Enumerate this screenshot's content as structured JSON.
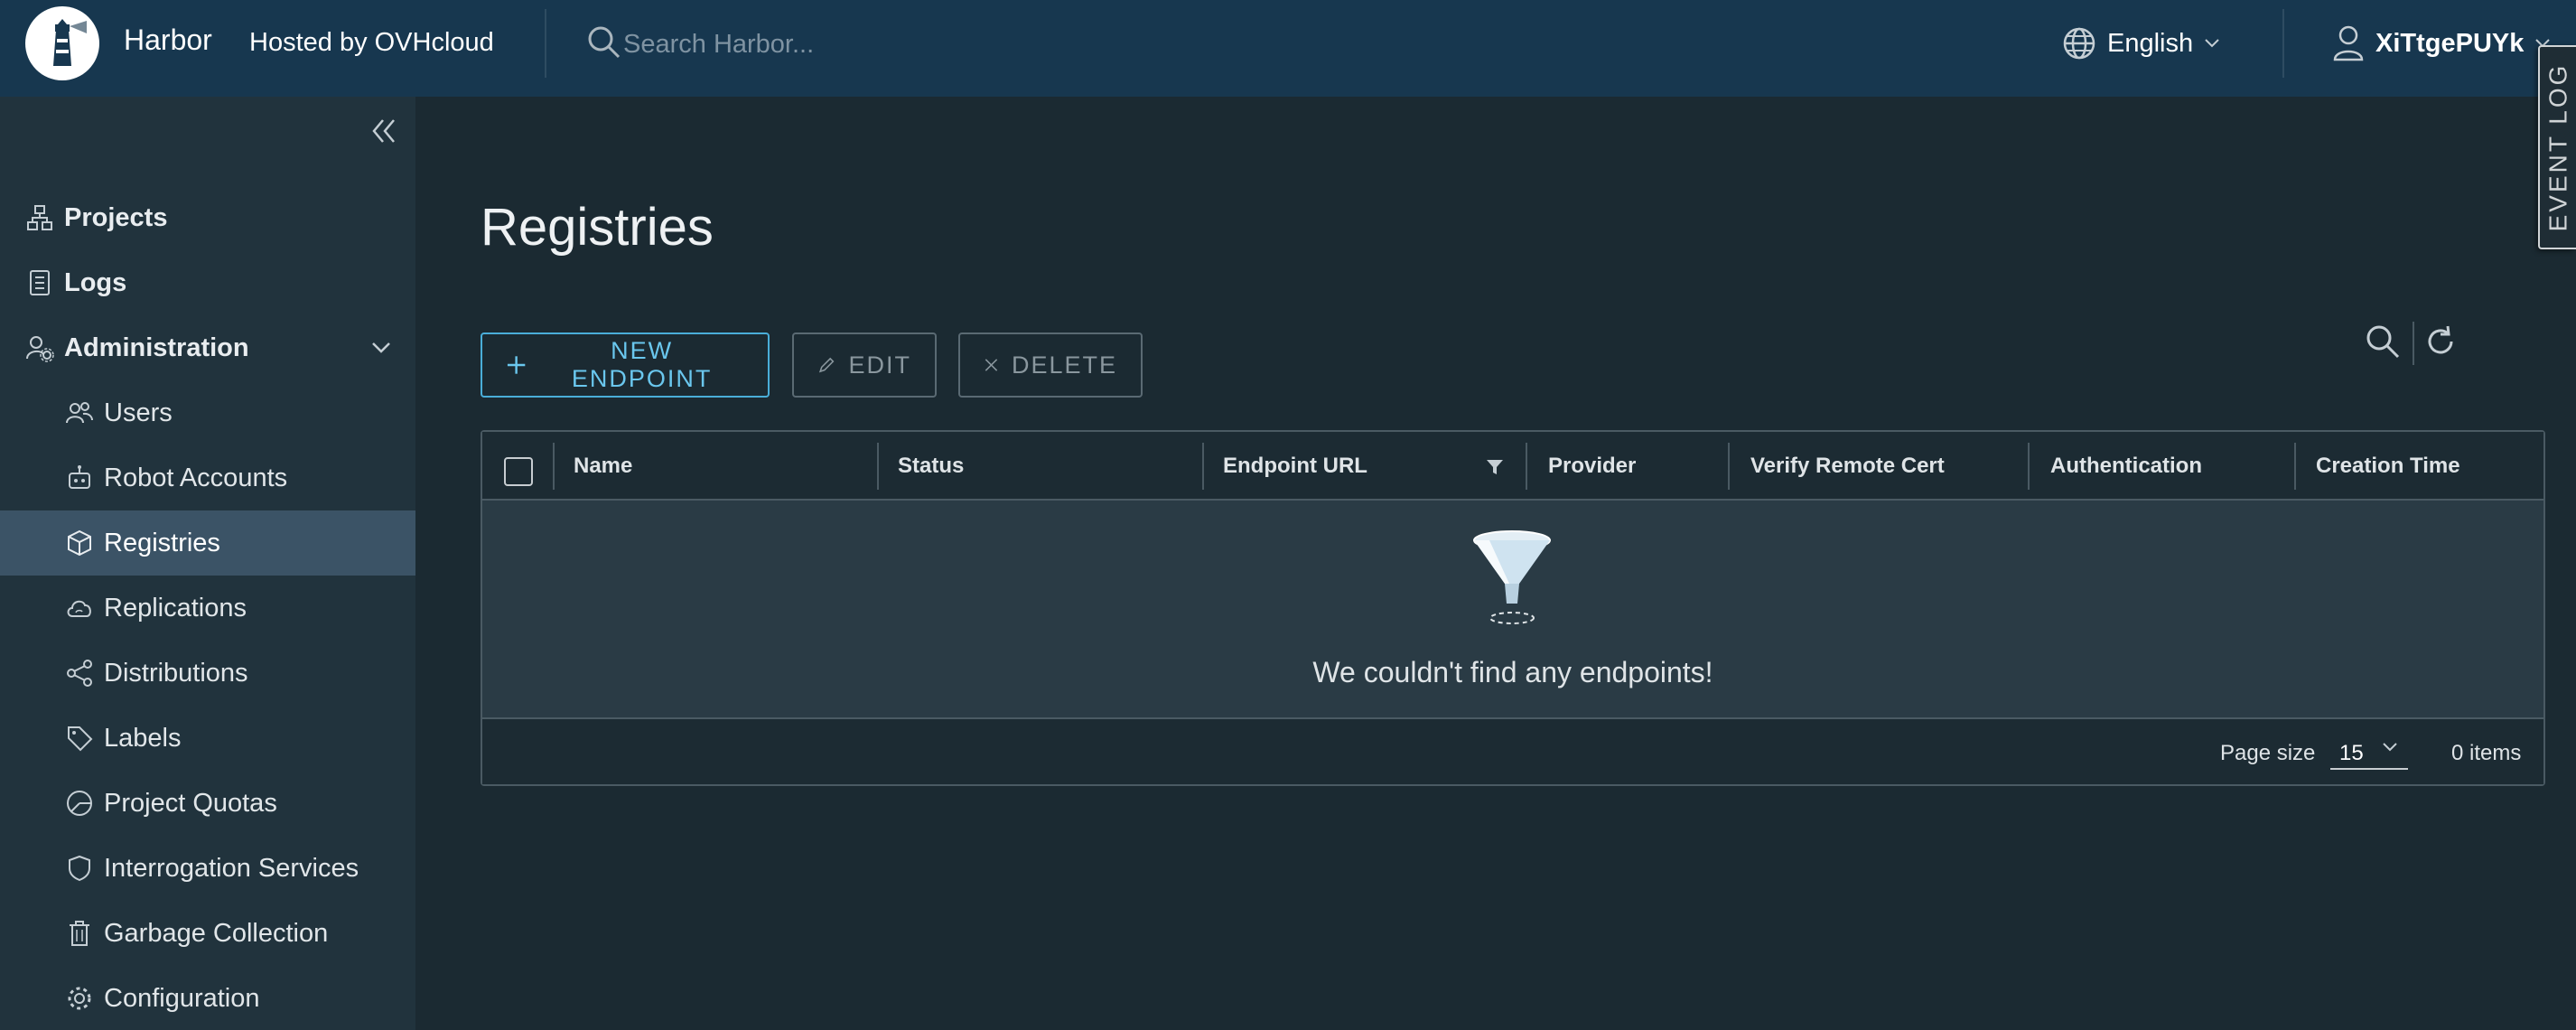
{
  "header": {
    "brand": "Harbor",
    "hosted_by": "Hosted by OVHcloud",
    "search_placeholder": "Search Harbor...",
    "language": "English",
    "username": "XiTtgePUYk",
    "event_log": "EVENT LOG"
  },
  "sidebar": {
    "items": [
      {
        "label": "Projects",
        "icon": "projects-icon"
      },
      {
        "label": "Logs",
        "icon": "logs-icon"
      },
      {
        "label": "Administration",
        "icon": "administration-icon",
        "expanded": true
      },
      {
        "label": "Users",
        "icon": "users-icon"
      },
      {
        "label": "Robot Accounts",
        "icon": "robot-icon"
      },
      {
        "label": "Registries",
        "icon": "registry-box-icon",
        "active": true
      },
      {
        "label": "Replications",
        "icon": "cloud-sync-icon"
      },
      {
        "label": "Distributions",
        "icon": "share-icon"
      },
      {
        "label": "Labels",
        "icon": "tag-icon"
      },
      {
        "label": "Project Quotas",
        "icon": "pie-icon"
      },
      {
        "label": "Interrogation Services",
        "icon": "shield-icon"
      },
      {
        "label": "Garbage Collection",
        "icon": "trash-icon"
      },
      {
        "label": "Configuration",
        "icon": "gear-icon"
      }
    ]
  },
  "main": {
    "title": "Registries",
    "buttons": {
      "new_endpoint": "NEW ENDPOINT",
      "edit": "EDIT",
      "delete": "DELETE"
    },
    "columns": [
      "Name",
      "Status",
      "Endpoint URL",
      "Provider",
      "Verify Remote Cert",
      "Authentication",
      "Creation Time"
    ],
    "empty_message": "We couldn't find any endpoints!",
    "footer": {
      "page_size_label": "Page size",
      "page_size": "15",
      "items_count": "0 items"
    }
  },
  "colors": {
    "header_bg": "#17374f",
    "sidebar_bg": "#21333d",
    "main_bg": "#1b2a32",
    "active_item_bg": "#3b5366",
    "accent": "#4aaed9"
  }
}
